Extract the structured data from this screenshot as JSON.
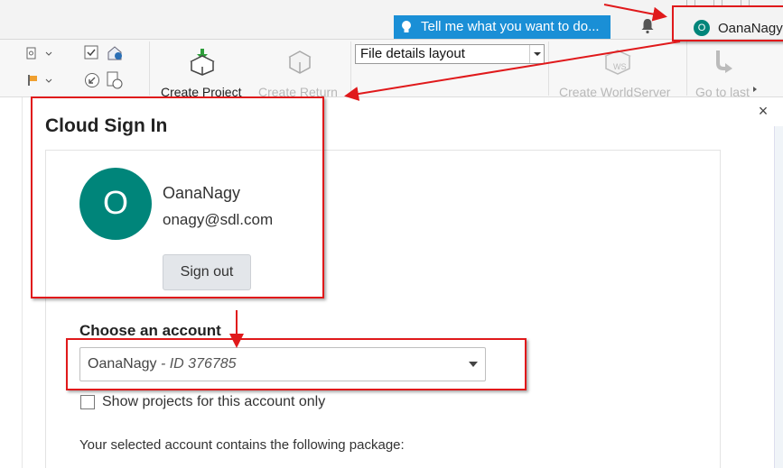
{
  "header": {
    "tell_me": "Tell me what you want to do...",
    "user_initial": "O",
    "user_name": "OanaNagy"
  },
  "ribbon": {
    "create_project": "Create Project",
    "create_return": "Create Return",
    "layout_select_value": "File details layout",
    "create_worldserver": "Create WorldServer",
    "go_to_last": "Go to last",
    "worldserver_badge": "WS"
  },
  "dialog": {
    "title": "Cloud Sign In",
    "close": "×",
    "account": {
      "initial": "O",
      "name": "OanaNagy",
      "email": "onagy@sdl.com",
      "sign_out": "Sign out"
    },
    "choose_label": "Choose an account",
    "select": {
      "name": "OanaNagy",
      "separator": " - ",
      "id_text": "ID 376785"
    },
    "checkbox_label": "Show projects for this account only",
    "checkbox_checked": false,
    "package_text": "Your selected account contains the following package:"
  },
  "colors": {
    "accent_teal": "#00857a",
    "tell_me_blue": "#1a8fd6",
    "annotation_red": "#e0191b"
  }
}
